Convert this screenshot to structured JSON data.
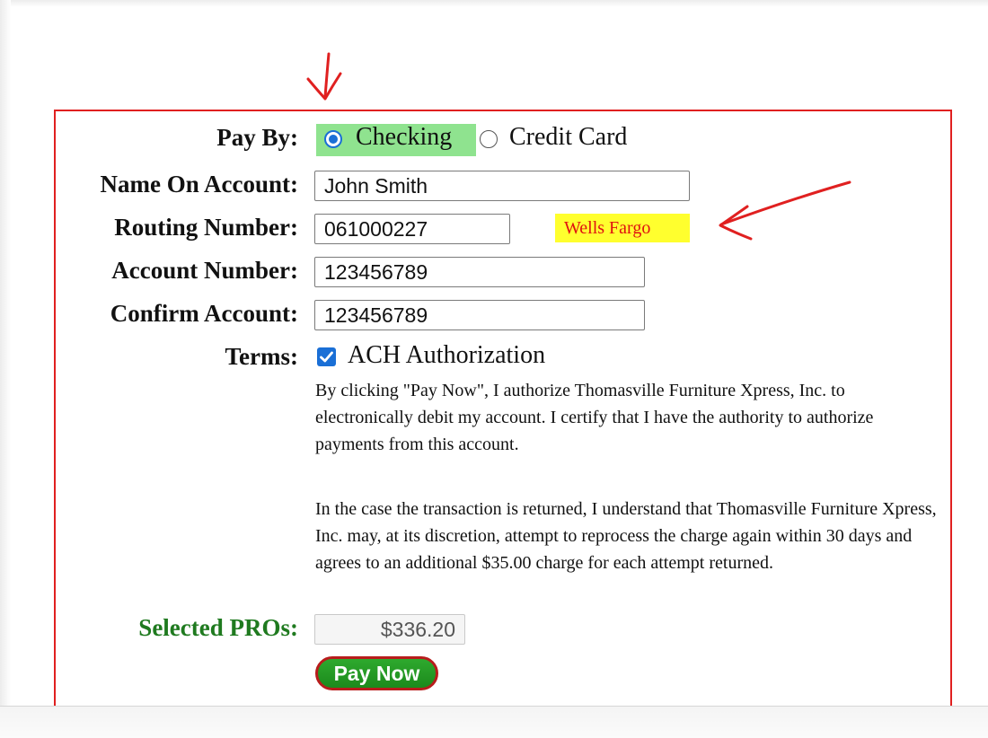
{
  "form": {
    "pay_by": {
      "label": "Pay By:",
      "options": [
        {
          "label": "Checking",
          "selected": true
        },
        {
          "label": "Credit Card",
          "selected": false
        }
      ]
    },
    "name_on_account": {
      "label": "Name On Account:",
      "value": "John Smith"
    },
    "routing_number": {
      "label": "Routing Number:",
      "value": "061000227",
      "bank_name": "Wells Fargo"
    },
    "account_number": {
      "label": "Account Number:",
      "value": "123456789"
    },
    "confirm_account": {
      "label": "Confirm Account:",
      "value": "123456789"
    },
    "terms": {
      "label": "Terms:",
      "checkbox_label": "ACH Authorization",
      "checked": true,
      "paragraph_1": "By clicking \"Pay Now\", I authorize Thomasville Furniture Xpress, Inc. to electronically debit my account. I certify that I have the authority to authorize payments from this account.",
      "paragraph_2": "In the case the transaction is returned, I understand that Thomasville Furniture Xpress, Inc. may, at its discretion, attempt to reprocess the charge again within 30 days and agrees to an additional $35.00 charge for each attempt returned."
    },
    "selected_pros": {
      "label": "Selected PROs:",
      "value": "$336.20"
    },
    "pay_button_label": "Pay Now"
  },
  "colors": {
    "frame_border": "#e02020",
    "radio_highlight": "#8fe38f",
    "bank_badge_bg": "#ffff2e",
    "bank_badge_text": "#e01010",
    "pay_button_bg": "#1c8a1c",
    "accent_blue": "#1a6fd6",
    "label_green": "#1f7a1f",
    "annotation_arrow": "#e02020"
  },
  "annotations": [
    {
      "type": "arrow",
      "icon": "red-down-arrow-icon",
      "points_to": "checking-option"
    },
    {
      "type": "arrow",
      "icon": "red-left-arrow-icon",
      "points_to": "bank-name-badge"
    }
  ]
}
